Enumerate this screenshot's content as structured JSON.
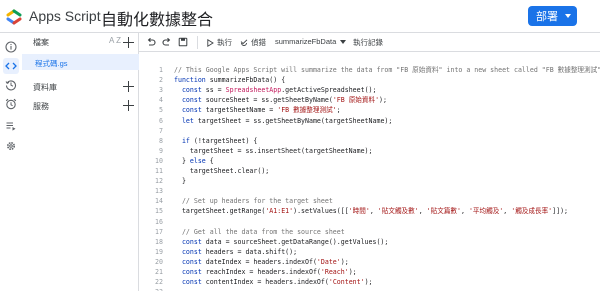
{
  "header": {
    "app_name": "Apps Script",
    "project_title": "自動化數據整合",
    "deploy_label": "部署"
  },
  "rail": {
    "icons": [
      "info-icon",
      "code-icon",
      "clock-icon",
      "alarm-icon",
      "executions-icon",
      "gear-icon"
    ]
  },
  "files_panel": {
    "title": "檔案",
    "sort_label": "A Z",
    "file_name": "程式碼.gs",
    "sections": [
      "資料庫",
      "服務"
    ]
  },
  "toolbar": {
    "run_label": "執行",
    "debug_label": "偵錯",
    "function_name": "summarizeFbData",
    "log_label": "執行記錄"
  },
  "code_lines": [
    {
      "n": "1",
      "segs": [
        [
          "c-com",
          "// This Google Apps Script will summarize the data from \"FB 原始資料\" into a new sheet called \"FB 數據整理測試\""
        ]
      ]
    },
    {
      "n": "2",
      "segs": [
        [
          "c-kw",
          "function "
        ],
        [
          "",
          "summarizeFbData() {"
        ]
      ]
    },
    {
      "n": "3",
      "segs": [
        [
          "c-kw",
          "  const "
        ],
        [
          "",
          "ss = "
        ],
        [
          "c-obj",
          "SpreadsheetApp"
        ],
        [
          "",
          ".getActiveSpreadsheet();"
        ]
      ]
    },
    {
      "n": "4",
      "segs": [
        [
          "c-kw",
          "  const "
        ],
        [
          "",
          "sourceSheet = ss.getSheetByName("
        ],
        [
          "c-str",
          "'FB 原始資料'"
        ],
        [
          "",
          ");"
        ]
      ]
    },
    {
      "n": "5",
      "segs": [
        [
          "c-kw",
          "  const "
        ],
        [
          "",
          "targetSheetName = "
        ],
        [
          "c-str",
          "'FB 數據整理測試'"
        ],
        [
          "",
          ";"
        ]
      ]
    },
    {
      "n": "6",
      "segs": [
        [
          "c-kw",
          "  let "
        ],
        [
          "",
          "targetSheet = ss.getSheetByName(targetSheetName);"
        ]
      ]
    },
    {
      "n": "7",
      "segs": [
        [
          "",
          ""
        ]
      ]
    },
    {
      "n": "8",
      "segs": [
        [
          "c-kw",
          "  if "
        ],
        [
          "",
          "(!targetSheet) {"
        ]
      ]
    },
    {
      "n": "9",
      "segs": [
        [
          "",
          "    targetSheet = ss.insertSheet(targetSheetName);"
        ]
      ]
    },
    {
      "n": "10",
      "segs": [
        [
          "",
          "  } "
        ],
        [
          "c-kw",
          "else "
        ],
        [
          "",
          "{"
        ]
      ]
    },
    {
      "n": "11",
      "segs": [
        [
          "",
          "    targetSheet.clear();"
        ]
      ]
    },
    {
      "n": "12",
      "segs": [
        [
          "",
          "  }"
        ]
      ]
    },
    {
      "n": "13",
      "segs": [
        [
          "",
          ""
        ]
      ]
    },
    {
      "n": "14",
      "segs": [
        [
          "c-com",
          "  // Set up headers for the target sheet"
        ]
      ]
    },
    {
      "n": "15",
      "segs": [
        [
          "",
          "  targetSheet.getRange("
        ],
        [
          "c-str",
          "'A1:E1'"
        ],
        [
          "",
          ").setValues([["
        ],
        [
          "c-str",
          "'時間'"
        ],
        [
          "",
          ", "
        ],
        [
          "c-str",
          "'貼文觸及數'"
        ],
        [
          "",
          ", "
        ],
        [
          "c-str",
          "'貼文篇數'"
        ],
        [
          "",
          ", "
        ],
        [
          "c-str",
          "'平均觸及'"
        ],
        [
          "",
          ", "
        ],
        [
          "c-str",
          "'觸及成長率'"
        ],
        [
          "",
          "]]);"
        ]
      ]
    },
    {
      "n": "16",
      "segs": [
        [
          "",
          ""
        ]
      ]
    },
    {
      "n": "17",
      "segs": [
        [
          "c-com",
          "  // Get all the data from the source sheet"
        ]
      ]
    },
    {
      "n": "18",
      "segs": [
        [
          "c-kw",
          "  const "
        ],
        [
          "",
          "data = sourceSheet.getDataRange().getValues();"
        ]
      ]
    },
    {
      "n": "19",
      "segs": [
        [
          "c-kw",
          "  const "
        ],
        [
          "",
          "headers = data.shift();"
        ]
      ]
    },
    {
      "n": "20",
      "segs": [
        [
          "c-kw",
          "  const "
        ],
        [
          "",
          "dateIndex = headers.indexOf("
        ],
        [
          "c-str",
          "'Date'"
        ],
        [
          "",
          ");"
        ]
      ]
    },
    {
      "n": "21",
      "segs": [
        [
          "c-kw",
          "  const "
        ],
        [
          "",
          "reachIndex = headers.indexOf("
        ],
        [
          "c-str",
          "'Reach'"
        ],
        [
          "",
          ");"
        ]
      ]
    },
    {
      "n": "22",
      "segs": [
        [
          "c-kw",
          "  const "
        ],
        [
          "",
          "contentIndex = headers.indexOf("
        ],
        [
          "c-str",
          "'Content'"
        ],
        [
          "",
          ");"
        ]
      ]
    },
    {
      "n": "23",
      "segs": [
        [
          "",
          ""
        ]
      ]
    }
  ]
}
